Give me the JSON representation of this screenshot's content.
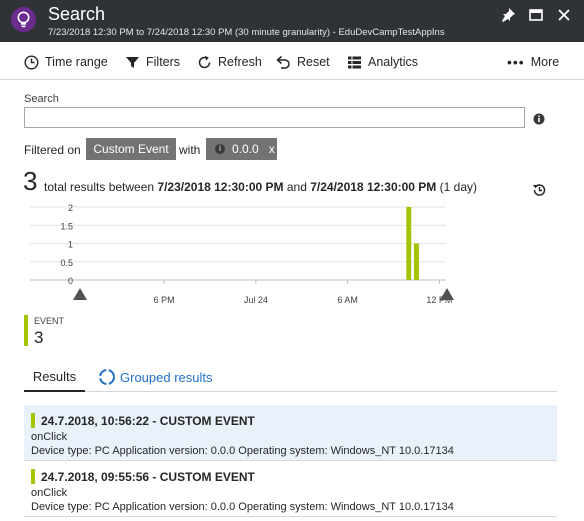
{
  "titlebar": {
    "title": "Search",
    "subtitle": "7/23/2018 12:30 PM to 7/24/2018 12:30 PM (30 minute granularity) - EduDevCampTestAppIns",
    "app_icon": "lightbulb-icon",
    "pin_icon": "pin-icon",
    "maximize_icon": "maximize-icon",
    "close_icon": "close-icon"
  },
  "toolbar": {
    "time_range": "Time range",
    "filters": "Filters",
    "refresh": "Refresh",
    "reset": "Reset",
    "analytics": "Analytics",
    "more": "More"
  },
  "search": {
    "label": "Search",
    "value": "",
    "placeholder": ""
  },
  "filters": {
    "filtered_on": "Filtered on",
    "event_chip": "Custom Event",
    "with": "with",
    "version_chip": "0.0.0",
    "version_remove": "x"
  },
  "summary": {
    "count": "3",
    "text_prefix": "total results between",
    "start": "7/23/2018 12:30:00 PM",
    "and": "and",
    "end": "7/24/2018 12:30:00 PM",
    "range": "(1 day)"
  },
  "chart_data": {
    "type": "bar",
    "y_ticks": [
      "2",
      "1.5",
      "1",
      "0.5",
      "0"
    ],
    "x_ticks": [
      "6 PM",
      "Jul 24",
      "6 AM",
      "12 PM"
    ],
    "ylim": [
      0,
      2.2
    ],
    "series": [
      {
        "name": "EVENT",
        "color": "#a4c400",
        "x_hours": [
          21.5,
          22.0
        ],
        "values": [
          2,
          1
        ]
      }
    ],
    "grid": true
  },
  "legend": {
    "label": "EVENT",
    "count": "3",
    "color": "#a4c400"
  },
  "tabs": {
    "results": "Results",
    "grouped": "Grouped results"
  },
  "results": [
    {
      "title": "24.7.2018, 10:56:22 - CUSTOM EVENT",
      "name": "onClick",
      "details": "Device type: PC  Application version: 0.0.0  Operating system: Windows_NT 10.0.17134"
    },
    {
      "title": "24.7.2018, 09:55:56 - CUSTOM EVENT",
      "name": "onClick",
      "details": "Device type: PC  Application version: 0.0.0  Operating system: Windows_NT 10.0.17134"
    }
  ],
  "colors": {
    "titlebar": "#2f3337",
    "accent_link": "#2271c8",
    "event": "#a4c400",
    "chip": "#737373",
    "selected_row": "#e9f2fb"
  }
}
